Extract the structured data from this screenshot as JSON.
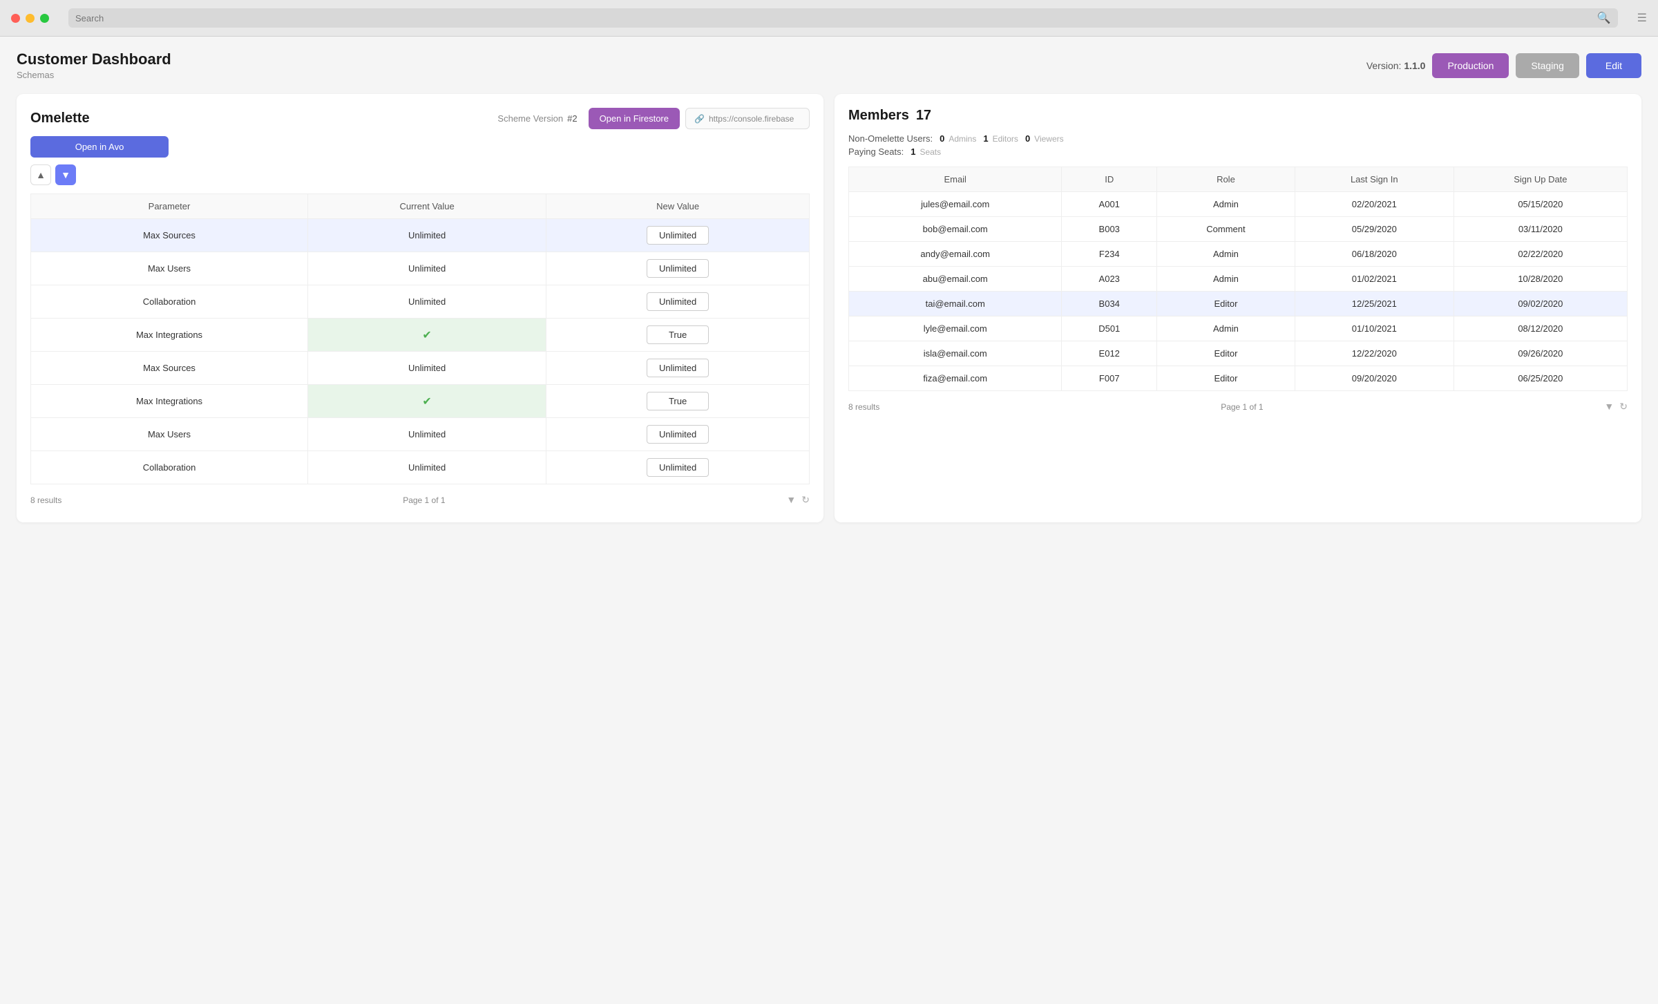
{
  "window": {
    "search_placeholder": "Search"
  },
  "header": {
    "title": "Customer Dashboard",
    "subtitle": "Schemas",
    "version_label": "Version:",
    "version_number": "1.1.0",
    "btn_production": "Production",
    "btn_staging": "Staging",
    "btn_edit": "Edit"
  },
  "left_panel": {
    "title": "Omelette",
    "scheme_label": "Scheme Version",
    "scheme_version": "#2",
    "btn_firestore": "Open in Firestore",
    "btn_avo": "Open in Avo",
    "firebase_url": "https://console.firebase",
    "table": {
      "columns": [
        "Parameter",
        "Current Value",
        "New Value"
      ],
      "rows": [
        {
          "parameter": "Max Sources",
          "current": "Unlimited",
          "new_value": "Unlimited",
          "highlighted": true,
          "green_current": false
        },
        {
          "parameter": "Max Users",
          "current": "Unlimited",
          "new_value": "Unlimited",
          "highlighted": false,
          "green_current": false
        },
        {
          "parameter": "Collaboration",
          "current": "Unlimited",
          "new_value": "Unlimited",
          "highlighted": false,
          "green_current": false
        },
        {
          "parameter": "Max Integrations",
          "current": "✔",
          "new_value": "True",
          "highlighted": false,
          "green_current": true
        },
        {
          "parameter": "Max Sources",
          "current": "Unlimited",
          "new_value": "Unlimited",
          "highlighted": false,
          "green_current": false
        },
        {
          "parameter": "Max Integrations",
          "current": "✔",
          "new_value": "True",
          "highlighted": false,
          "green_current": true
        },
        {
          "parameter": "Max Users",
          "current": "Unlimited",
          "new_value": "Unlimited",
          "highlighted": false,
          "green_current": false
        },
        {
          "parameter": "Collaboration",
          "current": "Unlimited",
          "new_value": "Unlimited",
          "highlighted": false,
          "green_current": false
        }
      ],
      "results_label": "8 results",
      "page_label": "Page 1 of 1"
    }
  },
  "right_panel": {
    "title": "Members",
    "count": "17",
    "stats": {
      "non_omelette_label": "Non-Omelette Users:",
      "admins_count": "0",
      "admins_label": "Admins",
      "editors_count": "1",
      "editors_label": "Editors",
      "viewers_count": "0",
      "viewers_label": "Viewers",
      "paying_seats_label": "Paying Seats:",
      "seats_count": "1",
      "seats_label": "Seats"
    },
    "table": {
      "columns": [
        "Email",
        "ID",
        "Role",
        "Last Sign In",
        "Sign Up Date"
      ],
      "rows": [
        {
          "email": "jules@email.com",
          "id": "A001",
          "role": "Admin",
          "last_sign_in": "02/20/2021",
          "sign_up_date": "05/15/2020",
          "highlighted": false
        },
        {
          "email": "bob@email.com",
          "id": "B003",
          "role": "Comment",
          "last_sign_in": "05/29/2020",
          "sign_up_date": "03/11/2020",
          "highlighted": false
        },
        {
          "email": "andy@email.com",
          "id": "F234",
          "role": "Admin",
          "last_sign_in": "06/18/2020",
          "sign_up_date": "02/22/2020",
          "highlighted": false
        },
        {
          "email": "abu@email.com",
          "id": "A023",
          "role": "Admin",
          "last_sign_in": "01/02/2021",
          "sign_up_date": "10/28/2020",
          "highlighted": false
        },
        {
          "email": "tai@email.com",
          "id": "B034",
          "role": "Editor",
          "last_sign_in": "12/25/2021",
          "sign_up_date": "09/02/2020",
          "highlighted": true
        },
        {
          "email": "lyle@email.com",
          "id": "D501",
          "role": "Admin",
          "last_sign_in": "01/10/2021",
          "sign_up_date": "08/12/2020",
          "highlighted": false
        },
        {
          "email": "isla@email.com",
          "id": "E012",
          "role": "Editor",
          "last_sign_in": "12/22/2020",
          "sign_up_date": "09/26/2020",
          "highlighted": false
        },
        {
          "email": "fiza@email.com",
          "id": "F007",
          "role": "Editor",
          "last_sign_in": "09/20/2020",
          "sign_up_date": "06/25/2020",
          "highlighted": false
        }
      ],
      "results_label": "8 results",
      "page_label": "Page 1 of 1"
    }
  }
}
